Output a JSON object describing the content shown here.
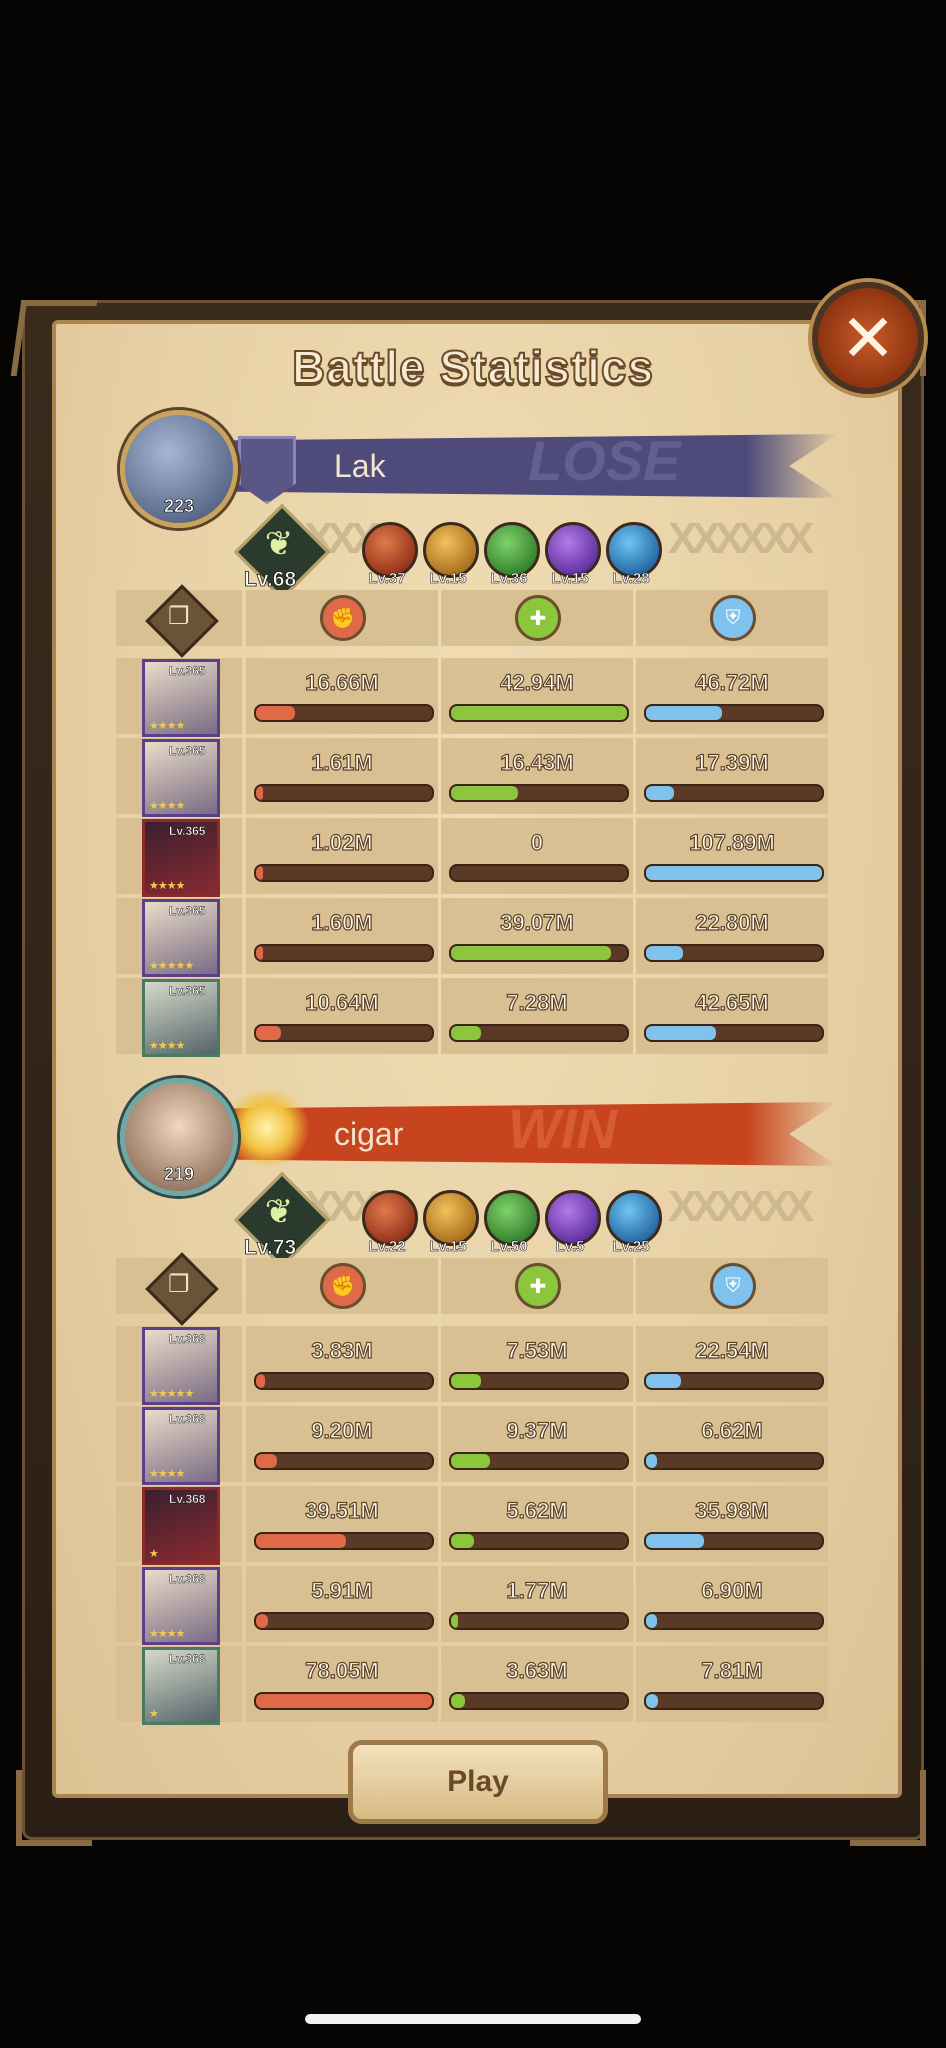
{
  "title": "Battle Statistics",
  "close_symbol": "✕",
  "play_label": "Play",
  "colors": {
    "damage": "#e06a47",
    "heal": "#8bc63d",
    "shield": "#7fc2ee",
    "lose_banner": "#4e4a7a",
    "win_banner": "#c8441e"
  },
  "header_icons": [
    "report-icon",
    "damage-icon",
    "heal-icon",
    "shield-icon"
  ],
  "players": [
    {
      "name": "Lak",
      "result": "LOSE",
      "avatar_level": "223",
      "formation_level": "Lv.68",
      "artifact_levels": [
        "Lv.37",
        "Lv.15",
        "Lv.36",
        "Lv.15",
        "Lv.28"
      ],
      "heroes": [
        {
          "level": "Lv.365",
          "stars": "★★★★",
          "damage": "16.66M",
          "heal": "42.94M",
          "taken": "46.72M",
          "dmg_fill": 0.22,
          "heal_fill": 1.0,
          "taken_fill": 0.43
        },
        {
          "level": "Lv.365",
          "stars": "★★★★",
          "damage": "1.61M",
          "heal": "16.43M",
          "taken": "17.39M",
          "dmg_fill": 0.03,
          "heal_fill": 0.38,
          "taken_fill": 0.16
        },
        {
          "level": "Lv.365",
          "stars": "★★★★",
          "damage": "1.02M",
          "heal": "0",
          "taken": "107.89M",
          "dmg_fill": 0.02,
          "heal_fill": 0.0,
          "taken_fill": 1.0
        },
        {
          "level": "Lv.365",
          "stars": "★★★★★",
          "damage": "1.60M",
          "heal": "39.07M",
          "taken": "22.80M",
          "dmg_fill": 0.03,
          "heal_fill": 0.91,
          "taken_fill": 0.21
        },
        {
          "level": "Lv.365",
          "stars": "★★★★",
          "damage": "10.64M",
          "heal": "7.28M",
          "taken": "42.65M",
          "dmg_fill": 0.14,
          "heal_fill": 0.17,
          "taken_fill": 0.4
        }
      ]
    },
    {
      "name": "cigar",
      "result": "WIN",
      "avatar_level": "219",
      "formation_level": "Lv.73",
      "artifact_levels": [
        "Lv.22",
        "Lv.15",
        "Lv.50",
        "Lv.5",
        "Lv.25"
      ],
      "heroes": [
        {
          "level": "Lv.368",
          "stars": "★★★★★",
          "damage": "3.83M",
          "heal": "7.53M",
          "taken": "22.54M",
          "dmg_fill": 0.05,
          "heal_fill": 0.17,
          "taken_fill": 0.2
        },
        {
          "level": "Lv.368",
          "stars": "★★★★",
          "damage": "9.20M",
          "heal": "9.37M",
          "taken": "6.62M",
          "dmg_fill": 0.12,
          "heal_fill": 0.22,
          "taken_fill": 0.06
        },
        {
          "level": "Lv.368",
          "stars": "★",
          "damage": "39.51M",
          "heal": "5.62M",
          "taken": "35.98M",
          "dmg_fill": 0.51,
          "heal_fill": 0.13,
          "taken_fill": 0.33
        },
        {
          "level": "Lv.368",
          "stars": "★★★★",
          "damage": "5.91M",
          "heal": "1.77M",
          "taken": "6.90M",
          "dmg_fill": 0.07,
          "heal_fill": 0.04,
          "taken_fill": 0.06
        },
        {
          "level": "Lv.368",
          "stars": "★",
          "damage": "78.05M",
          "heal": "3.63M",
          "taken": "7.81M",
          "dmg_fill": 1.0,
          "heal_fill": 0.08,
          "taken_fill": 0.07
        }
      ]
    }
  ]
}
